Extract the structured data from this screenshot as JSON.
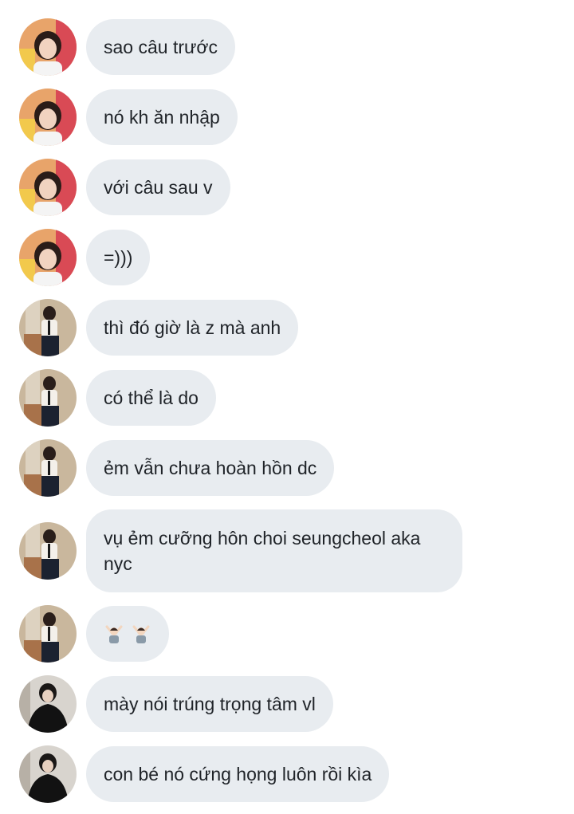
{
  "messages": [
    {
      "text": "sao câu trước",
      "avatar": "girl-pink-avatar"
    },
    {
      "text": "nó kh ăn nhập",
      "avatar": "girl-pink-avatar"
    },
    {
      "text": "với câu sau v",
      "avatar": "girl-pink-avatar"
    },
    {
      "text": "=)))",
      "avatar": "girl-pink-avatar"
    },
    {
      "text": "thì đó giờ là z mà anh",
      "avatar": "man-seated-avatar"
    },
    {
      "text": "có thể là do",
      "avatar": "man-seated-avatar"
    },
    {
      "text": "ẻm vẫn chưa hoàn hồn dc",
      "avatar": "man-seated-avatar"
    },
    {
      "text": "vụ ẻm cưỡng hôn choi seungcheol aka nyc",
      "avatar": "man-seated-avatar"
    },
    {
      "text": "🙆🏻‍♂️🙆🏻‍♂️",
      "avatar": "man-seated-avatar"
    },
    {
      "text": "mày nói trúng trọng tâm vl",
      "avatar": "man-black-avatar"
    },
    {
      "text": "con bé nó cứng họng luôn rồi kìa",
      "avatar": "man-black-avatar"
    }
  ],
  "colors": {
    "bubble": "#e8ecf0",
    "text": "#1f2328",
    "background": "#ffffff"
  }
}
